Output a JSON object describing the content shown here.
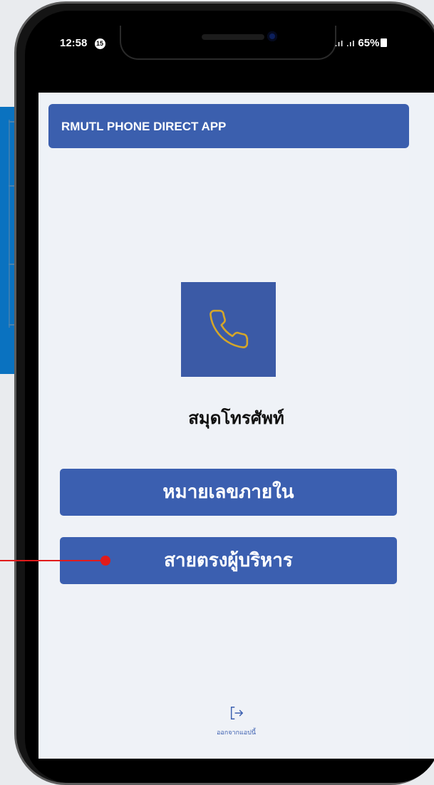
{
  "status_bar": {
    "time": "12:58",
    "notification_badge": "15",
    "signal": ".ıl .ıl",
    "battery": "65%"
  },
  "header": {
    "title": "RMUTL PHONE DIRECT APP"
  },
  "main": {
    "icon": "phone-icon",
    "app_title": "สมุดโทรศัพท์",
    "buttons": [
      {
        "label": "หมายเลขภายใน"
      },
      {
        "label": "สายตรงผู้บริหาร"
      }
    ]
  },
  "footer": {
    "logout_icon": "logout-icon",
    "logout_label": "ออกจากแอปนี้"
  },
  "colors": {
    "header_bg": "#3b5fae",
    "button_bg": "#3b5fb0",
    "icon_tile_bg": "#3b5aa6",
    "icon_stroke": "#d4a62a",
    "screen_bg": "#eef2f7",
    "annotation": "#e11b1b"
  }
}
